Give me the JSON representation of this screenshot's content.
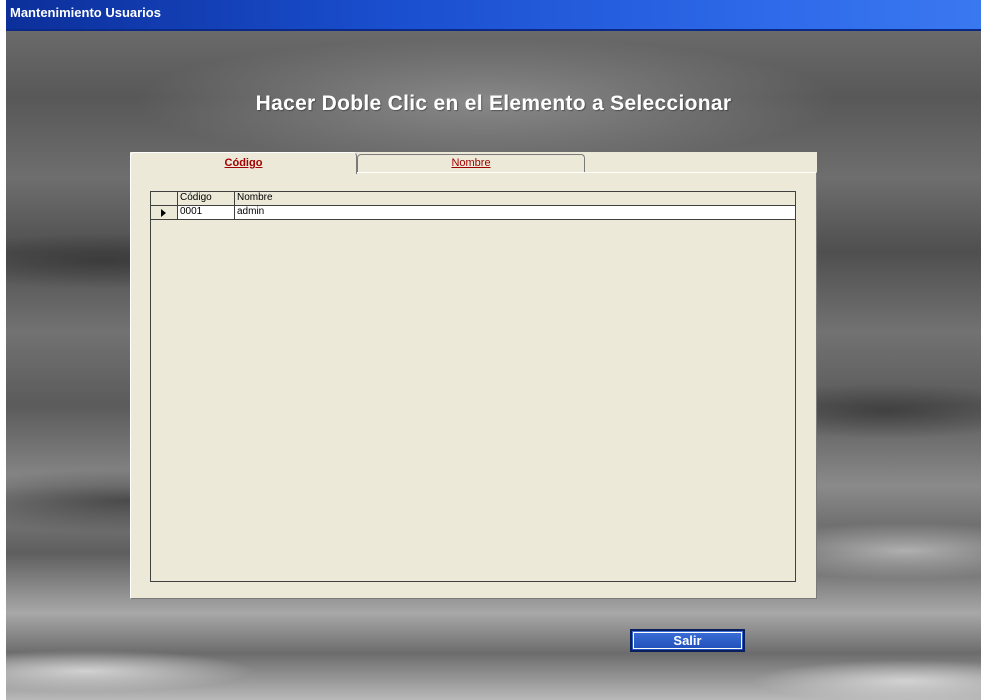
{
  "window": {
    "title": "Mantenimiento Usuarios"
  },
  "heading": "Hacer Doble Clic en el Elemento a Seleccionar",
  "tabs": [
    {
      "label": "Código",
      "active": true
    },
    {
      "label": "Nombre",
      "active": false
    }
  ],
  "grid": {
    "columns": [
      "Código",
      "Nombre"
    ],
    "rows": [
      {
        "codigo": "0001",
        "nombre": "admin",
        "current": true
      }
    ]
  },
  "buttons": {
    "exit_label": "Salir"
  },
  "colors": {
    "titlebar": "#1a4fcf",
    "tab_text": "#a00000",
    "panel": "#ece9d8",
    "button": "#1f4fb8"
  }
}
